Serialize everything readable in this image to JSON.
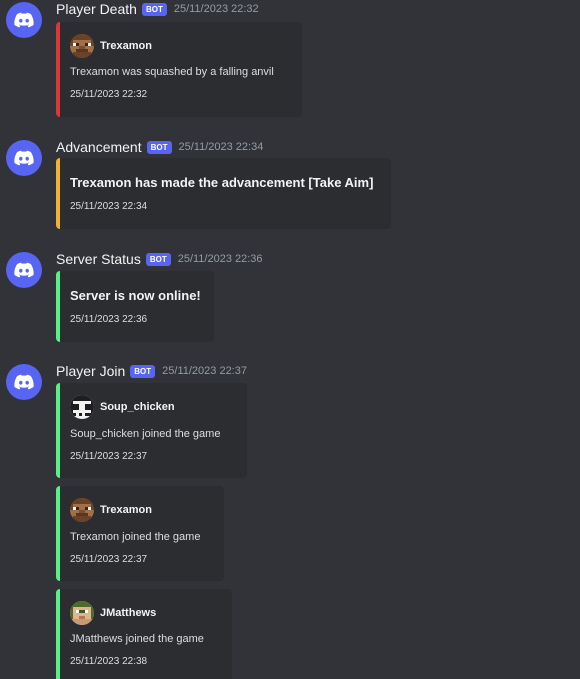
{
  "colors": {
    "background": "#313338",
    "embed_bg": "#2b2d31",
    "bot_tag": "#5865f2",
    "death": "#da373c",
    "advancement": "#f0b232",
    "status": "#57f287",
    "join": "#57f287"
  },
  "messages": [
    {
      "author": "Player Death",
      "bot_tag": "BOT",
      "timestamp": "25/11/2023 22:32",
      "avatar_icon": "discord-logo-icon",
      "embeds": [
        {
          "accent": "#da373c",
          "author_name": "Trexamon",
          "author_icon": "trexamon-head-icon",
          "description": "Trexamon was squashed by a falling anvil",
          "footer": "25/11/2023 22:32"
        }
      ]
    },
    {
      "author": "Advancement",
      "bot_tag": "BOT",
      "timestamp": "25/11/2023 22:34",
      "avatar_icon": "discord-logo-icon",
      "embeds": [
        {
          "accent": "#f0b232",
          "title": "Trexamon has made the advancement [Take Aim]",
          "footer": "25/11/2023 22:34"
        }
      ]
    },
    {
      "author": "Server Status",
      "bot_tag": "BOT",
      "timestamp": "25/11/2023 22:36",
      "avatar_icon": "discord-logo-icon",
      "embeds": [
        {
          "accent": "#57f287",
          "title": "Server is now online!",
          "footer": "25/11/2023 22:36"
        }
      ]
    },
    {
      "author": "Player Join",
      "bot_tag": "BOT",
      "timestamp": "25/11/2023 22:37",
      "avatar_icon": "discord-logo-icon",
      "embeds": [
        {
          "accent": "#57f287",
          "author_name": "Soup_chicken",
          "author_icon": "soup-chicken-head-icon",
          "description": "Soup_chicken joined the game",
          "footer": "25/11/2023 22:37"
        },
        {
          "accent": "#57f287",
          "author_name": "Trexamon",
          "author_icon": "trexamon-head-icon",
          "description": "Trexamon joined the game",
          "footer": "25/11/2023 22:37"
        },
        {
          "accent": "#57f287",
          "author_name": "JMatthews",
          "author_icon": "jmatthews-head-icon",
          "description": "JMatthews joined the game",
          "footer": "25/11/2023 22:38"
        }
      ]
    }
  ]
}
